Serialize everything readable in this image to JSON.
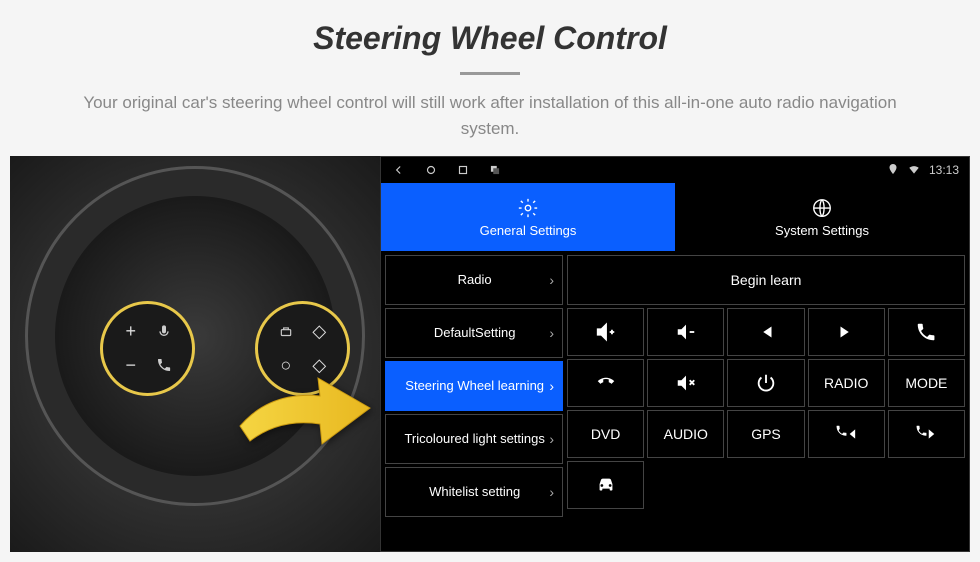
{
  "header": {
    "title": "Steering Wheel Control",
    "subtitle": "Your original car's steering wheel control will still work after installation of this all-in-one auto radio navigation system."
  },
  "statusbar": {
    "time": "13:13"
  },
  "tabs": {
    "general": "General Settings",
    "system": "System Settings"
  },
  "sidebar": {
    "items": [
      {
        "label": "Radio"
      },
      {
        "label": "DefaultSetting"
      },
      {
        "label": "Steering Wheel learning"
      },
      {
        "label": "Tricoloured light settings"
      },
      {
        "label": "Whitelist setting"
      }
    ]
  },
  "panel": {
    "begin": "Begin learn",
    "buttons": {
      "radio": "RADIO",
      "mode": "MODE",
      "dvd": "DVD",
      "audio": "AUDIO",
      "gps": "GPS"
    }
  },
  "icons": {
    "volup": "volume-up-icon",
    "voldown": "volume-down-icon",
    "prev": "previous-track-icon",
    "next": "next-track-icon",
    "phone": "phone-icon",
    "hangup": "hangup-icon",
    "mute": "mute-icon",
    "power": "power-icon",
    "callprev": "call-previous-icon",
    "callnext": "call-next-icon",
    "car": "car-icon"
  }
}
